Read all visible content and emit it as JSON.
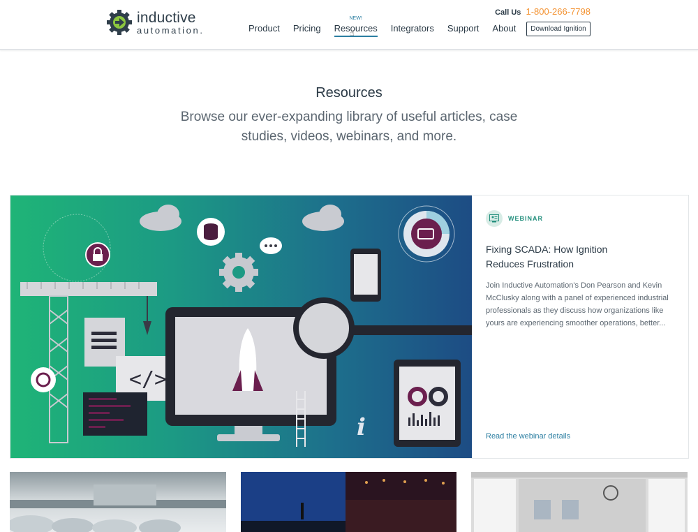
{
  "header": {
    "logo_line1": "inductive",
    "logo_line2": "automation.",
    "call_label": "Call Us",
    "phone": "1-800-266-7798",
    "nav": [
      {
        "label": "Product"
      },
      {
        "label": "Pricing"
      },
      {
        "label": "Resources",
        "badge": "NEW!",
        "active": true
      },
      {
        "label": "Integrators"
      },
      {
        "label": "Support"
      },
      {
        "label": "About"
      }
    ],
    "download_label": "Download Ignition"
  },
  "hero": {
    "title": "Resources",
    "subtitle": "Browse our ever-expanding library of useful articles, case studies, videos, webinars, and more."
  },
  "feature": {
    "tag": "WEBINAR",
    "title": "Fixing SCADA: How Ignition Reduces Frustration",
    "description": "Join Inductive Automation's Don Pearson and Kevin McClusky along with a panel of experienced industrial professionals as they discuss how organizations like yours are experiencing smoother operations, better...",
    "link": "Read the webinar details",
    "illustration_labels": {
      "info": "i",
      "code": "</>"
    }
  },
  "colors": {
    "accent_blue": "#2b7ea1",
    "phone_orange": "#f39231",
    "webinar_green": "#25907e",
    "hero_gradient_start": "#1fb477",
    "hero_gradient_end": "#1d4c84"
  },
  "icons": [
    "gear-logo-icon",
    "webinar-icon",
    "lock-icon",
    "database-icon",
    "chat-icon",
    "gear-icon",
    "tag-icon",
    "cloud-icon",
    "hand-cursor-icon"
  ]
}
